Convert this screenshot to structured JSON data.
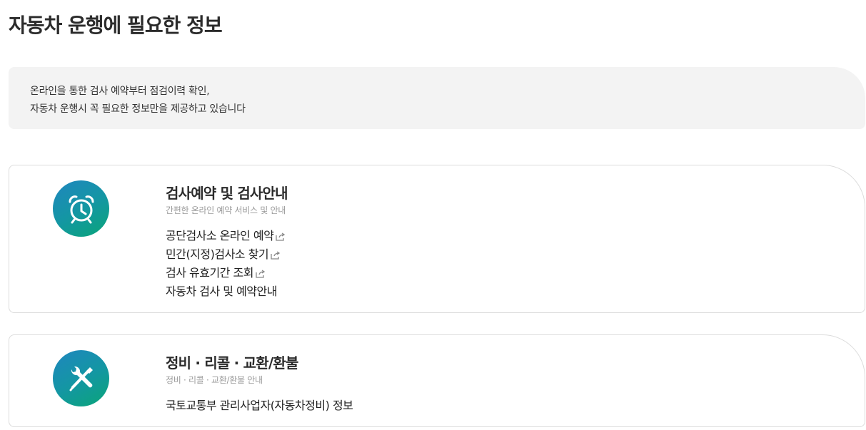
{
  "page": {
    "title": "자동차 운행에 필요한 정보"
  },
  "intro": {
    "line1": "온라인을 통한 검사 예약부터 점검이력 확인,",
    "line2": "자동차 운행시 꼭 필요한 정보만을 제공하고 있습니다"
  },
  "cards": [
    {
      "icon": "alarm-clock-icon",
      "title": "검사예약 및 검사안내",
      "subtitle": "간편한 온라인 예약 서비스 및 안내",
      "links": [
        {
          "label": "공단검사소 온라인 예약",
          "external": true
        },
        {
          "label": "민간(지정)검사소 찾기",
          "external": true
        },
        {
          "label": "검사 유효기간 조회",
          "external": true
        },
        {
          "label": "자동차 검사 및 예약안내",
          "external": false
        }
      ]
    },
    {
      "icon": "wrench-screwdriver-icon",
      "title": "정비 · 리콜 · 교환/환불",
      "subtitle": "정비 · 리콜 · 교환/환불 안내",
      "links": [
        {
          "label": "국토교통부 관리사업자(자동차정비) 정보",
          "external": false
        }
      ]
    }
  ],
  "colors": {
    "icon_gradient_start": "#1f86bf",
    "icon_gradient_end": "#0aa578",
    "intro_bg": "#f3f3f3",
    "subtitle_text": "#9a9a9a"
  }
}
